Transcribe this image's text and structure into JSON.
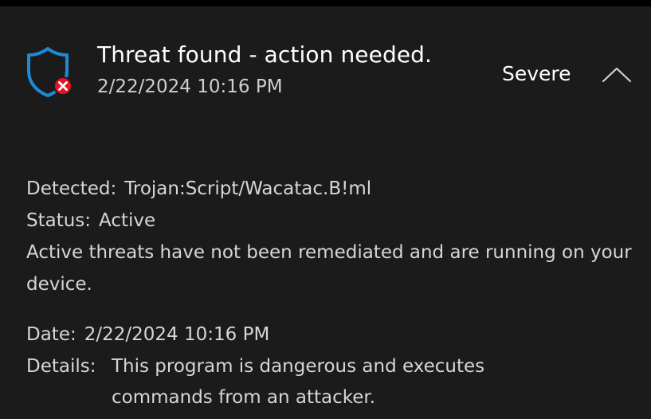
{
  "notification": {
    "title": "Threat found - action needed.",
    "timestamp": "2/22/2024 10:16 PM",
    "severity": "Severe",
    "icon": "shield-error-icon",
    "collapse_icon": "chevron-up-icon"
  },
  "threat": {
    "detected_label": "Detected:",
    "detected_value": "Trojan:Script/Wacatac.B!ml",
    "status_label": "Status:",
    "status_value": "Active",
    "description": "Active threats have not been remediated and are running on your device.",
    "date_label": "Date:",
    "date_value": "2/22/2024 10:16 PM",
    "details_label": "Details:",
    "details_value": "This program is dangerous and executes commands from an attacker."
  },
  "colors": {
    "background": "#1b1b1b",
    "shield_blue": "#1e8ad6",
    "error_red": "#e81123"
  }
}
